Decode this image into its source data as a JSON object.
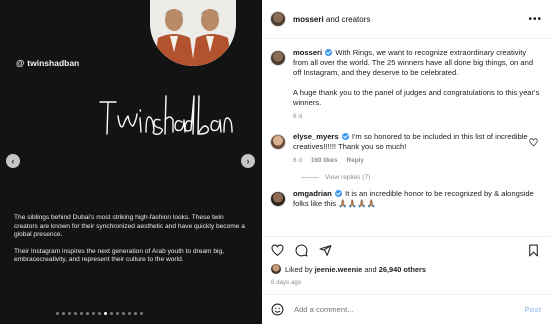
{
  "media": {
    "handle": "twinshadban",
    "signature_text": "TwinShadban",
    "caption_p1": "The siblings behind Dubai's most striking high-fashion looks. These twin creators are known for their synchronized aesthetic and have quickly become a global presence.",
    "caption_p2": "Their Instagram inspires the next generation of Arab youth to dream big, embracecreativity, and represent their culture to the world.",
    "prev_icon": "chevron-left-icon",
    "next_icon": "chevron-right-icon",
    "dots": 15,
    "active_dot": 8
  },
  "header": {
    "username": "mosseri",
    "suffix": "and creators",
    "more_icon": "more-horizontal-icon"
  },
  "caption": {
    "username": "mosseri",
    "text_p1": "With Rings, we want to recognize extraordinary creativity from all over the world. The 25 winners have all done big things, on and off Instagram, and they deserve to be celebrated.",
    "text_p2": "A huge thank you to the panel of judges and congratulations to this year's winners.",
    "time": "6 d"
  },
  "comments": [
    {
      "username": "elyse_myers",
      "text": "I'm so honored to be included in this list of incredible creatives!!!!!! Thank you so much!",
      "time": "6 d",
      "likes": "160 likes",
      "reply": "Reply"
    },
    {
      "username": "omgadrian",
      "text": "It is an incredible honor to be recognized by & alongside folks like this 🙏🏽🙏🏽🙏🏽🙏🏽"
    }
  ],
  "view_replies": "View replies (7)",
  "likes": {
    "prefix": "Liked by",
    "user": "jeenie.weenie",
    "and": "and",
    "count": "26,940 others"
  },
  "time_ago": "6 days ago",
  "add_comment": {
    "placeholder": "Add a comment...",
    "post": "Post"
  },
  "colors": {
    "accent": "#3897f0",
    "muted": "#8e8e8e",
    "dark": "#131313"
  }
}
